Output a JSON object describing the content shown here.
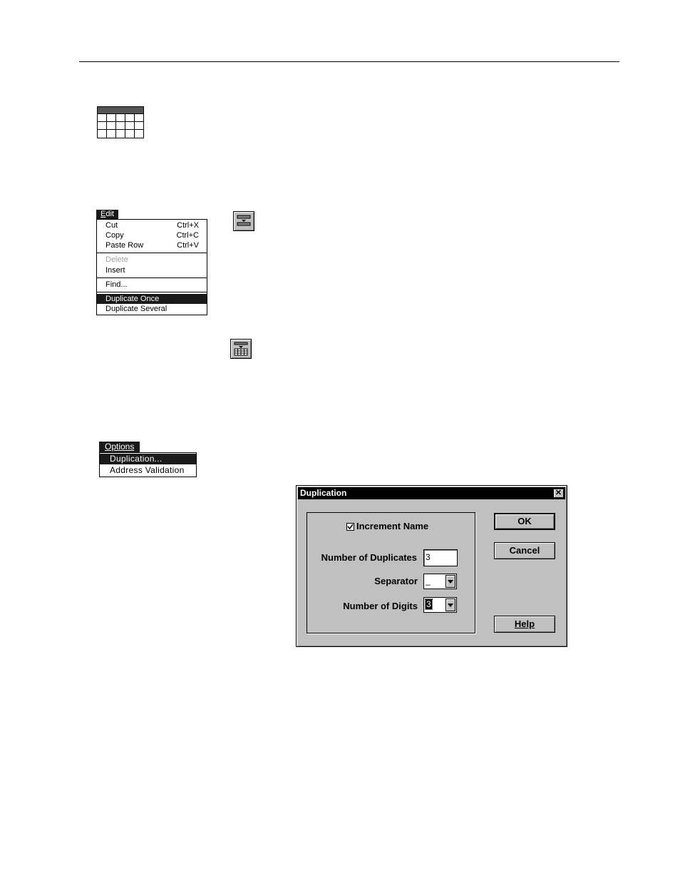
{
  "edit_menu": {
    "title_accel": "E",
    "title_rest": "dit",
    "items": [
      {
        "label": "Cut",
        "shortcut": "Ctrl+X"
      },
      {
        "label": "Copy",
        "shortcut": "Ctrl+C"
      },
      {
        "label": "Paste Row",
        "shortcut": "Ctrl+V"
      },
      {
        "label": "Delete",
        "shortcut": "",
        "disabled": true
      },
      {
        "label": "Insert",
        "shortcut": ""
      },
      {
        "label": "Find...",
        "shortcut": ""
      },
      {
        "label": "Duplicate Once",
        "shortcut": "",
        "selected": true
      },
      {
        "label": "Duplicate Several",
        "shortcut": ""
      }
    ]
  },
  "options_menu": {
    "title": "Options",
    "items": [
      {
        "label": "Duplication...",
        "selected": true
      },
      {
        "label": "Address Validation"
      }
    ]
  },
  "dialog": {
    "title": "Duplication",
    "close_glyph": "✕",
    "increment_name_label": "Increment Name",
    "increment_name_checked": true,
    "num_duplicates_label": "Number of Duplicates",
    "num_duplicates_value": "3",
    "separator_label": "Separator",
    "separator_value": "_",
    "num_digits_label": "Number of Digits",
    "num_digits_value": "3",
    "ok_label": "OK",
    "cancel_label": "Cancel",
    "help_label": "Help"
  },
  "icons": [
    "table-icon",
    "duplicate-once-toolbar-icon",
    "duplicate-several-toolbar-icon",
    "checkmark-icon",
    "dropdown-arrow-icon",
    "close-icon"
  ],
  "colors": {
    "menu_highlight": "#1a1a1a",
    "dialog_face": "#c0c0c0",
    "titlebar": "#000000"
  }
}
